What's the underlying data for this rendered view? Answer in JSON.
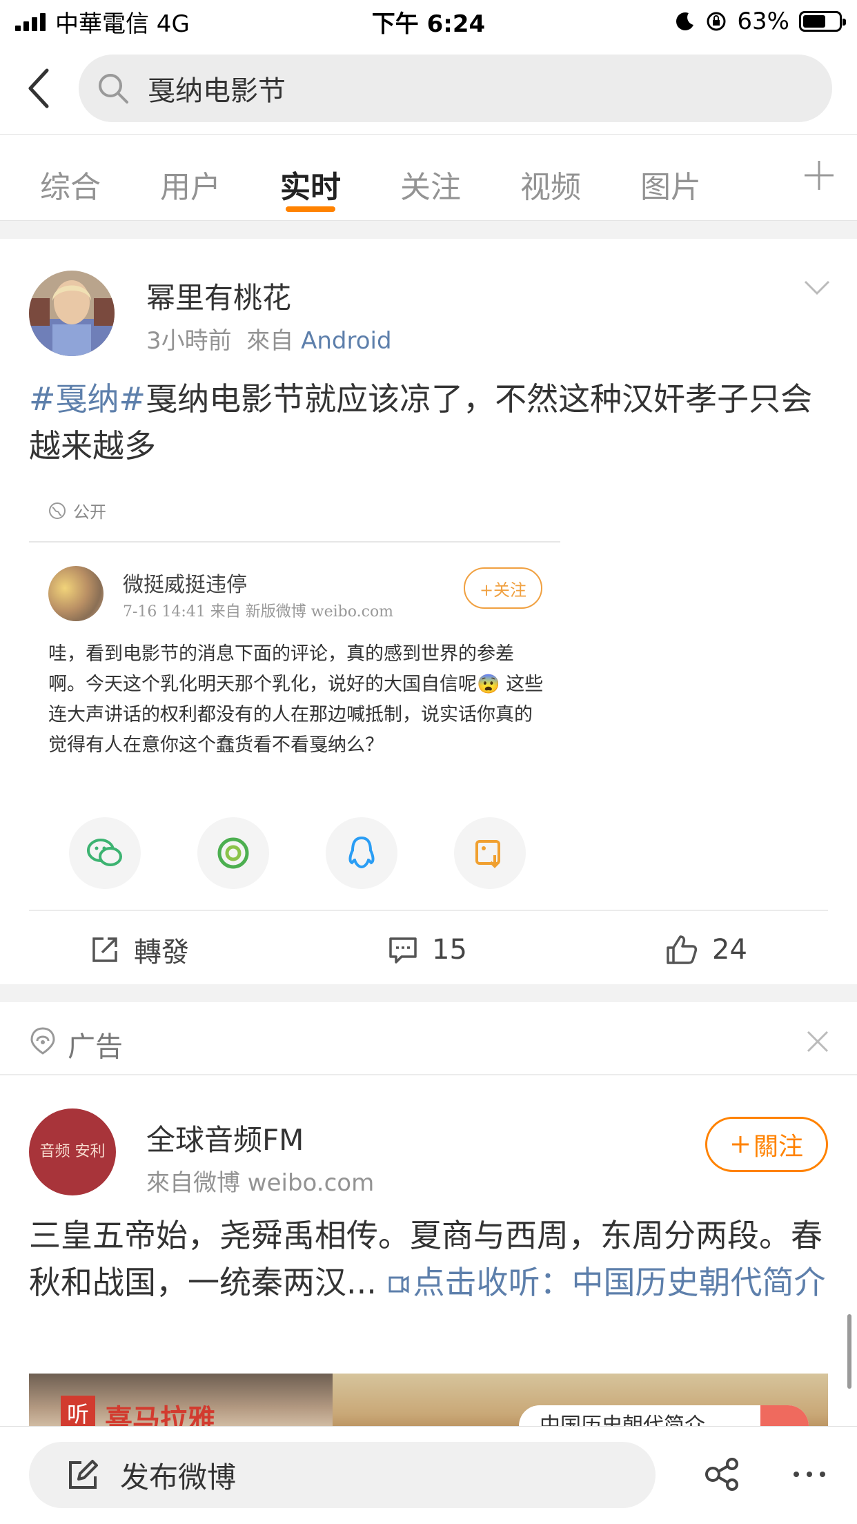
{
  "status_bar": {
    "carrier": "中華電信  4G",
    "time": "下午 6:24",
    "battery": "63%",
    "battery_level": 0.63
  },
  "search": {
    "query": "戛纳电影节"
  },
  "tabs": [
    {
      "label": "综合"
    },
    {
      "label": "用户"
    },
    {
      "label": "实时",
      "active": true
    },
    {
      "label": "关注"
    },
    {
      "label": "视频"
    },
    {
      "label": "图片"
    }
  ],
  "post": {
    "user_name": "幂里有桃花",
    "time_ago": "3小時前",
    "from_label": "來自",
    "source": "Android",
    "topic": "#戛纳#",
    "text": "戛纳电影节就应该凉了，不然这种汉奸孝子只会越来越多",
    "embedded": {
      "visibility": "公开",
      "user_name": "微挺威挺违停",
      "meta": "7-16 14:41  来自 新版微博 weibo.com",
      "follow_label": "+关注",
      "body": "哇，看到电影节的消息下面的评论，真的感到世界的参差啊。今天这个乳化明天那个乳化，说好的大国自信呢😨 这些连大声讲话的权利都没有的人在那边喊抵制，说实话你真的觉得有人在意你这个蠢货看不看戛纳么？",
      "share_icons": [
        "wechat-icon",
        "moments-icon",
        "qq-icon",
        "save-image-icon"
      ]
    },
    "actions": {
      "repost_label": "轉發",
      "comments": "15",
      "likes": "24"
    }
  },
  "ad": {
    "label": "广告",
    "avatar_text": "音频 安利",
    "user_name": "全球音频FM",
    "meta": "來自微博 weibo.com",
    "follow_label": "關注",
    "text": "三皇五帝始，尧舜禹相传。夏商与西周，东周分两段。春秋和战国，一统秦两汉... ",
    "link_text": "点击收听：中国历史朝代简介",
    "banner": {
      "left_logo": "听",
      "left_text": "喜马拉雅",
      "right_text": "中国历史朝代简介"
    }
  },
  "bottom_bar": {
    "compose_label": "发布微博"
  },
  "colors": {
    "accent": "#ff8200",
    "link": "#5d7fab"
  }
}
